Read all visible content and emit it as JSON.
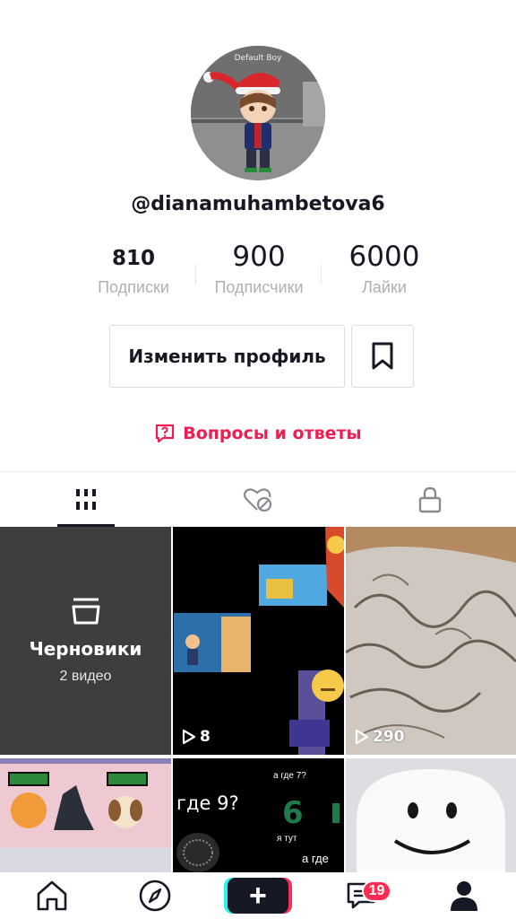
{
  "profile": {
    "avatar_caption": "Default Boy",
    "username": "@dianamuhambetova6",
    "stats": {
      "following_count": "810",
      "following_label": "Подписки",
      "followers_count": "900",
      "followers_label": "Подписчики",
      "likes_count": "6000",
      "likes_label": "Лайки"
    },
    "edit_button": "Изменить профиль",
    "qa_link": "Вопросы и ответы"
  },
  "tabs": [
    "videos-grid-icon",
    "liked-hidden-icon",
    "lock-icon"
  ],
  "grid": {
    "drafts_title": "Черновики",
    "drafts_subtitle": "2 видео",
    "video_1_views": "8",
    "video_2_views": "290",
    "video_4_text_main": "где 9?",
    "video_4_text_a": "а где 7?",
    "video_4_text_b": "я тут",
    "video_4_text_c": "а где",
    "video_4_digit": "6"
  },
  "nav": {
    "home_icon": "home-icon",
    "discover_icon": "compass-icon",
    "create_label": "+",
    "inbox_badge": "19",
    "profile_icon": "profile-icon"
  },
  "colors": {
    "accent": "#fe2c55",
    "qa_text": "#ee1d52",
    "text_primary": "#161823",
    "text_secondary": "#b0b0b4",
    "drafts_bg": "#3e3e40"
  }
}
